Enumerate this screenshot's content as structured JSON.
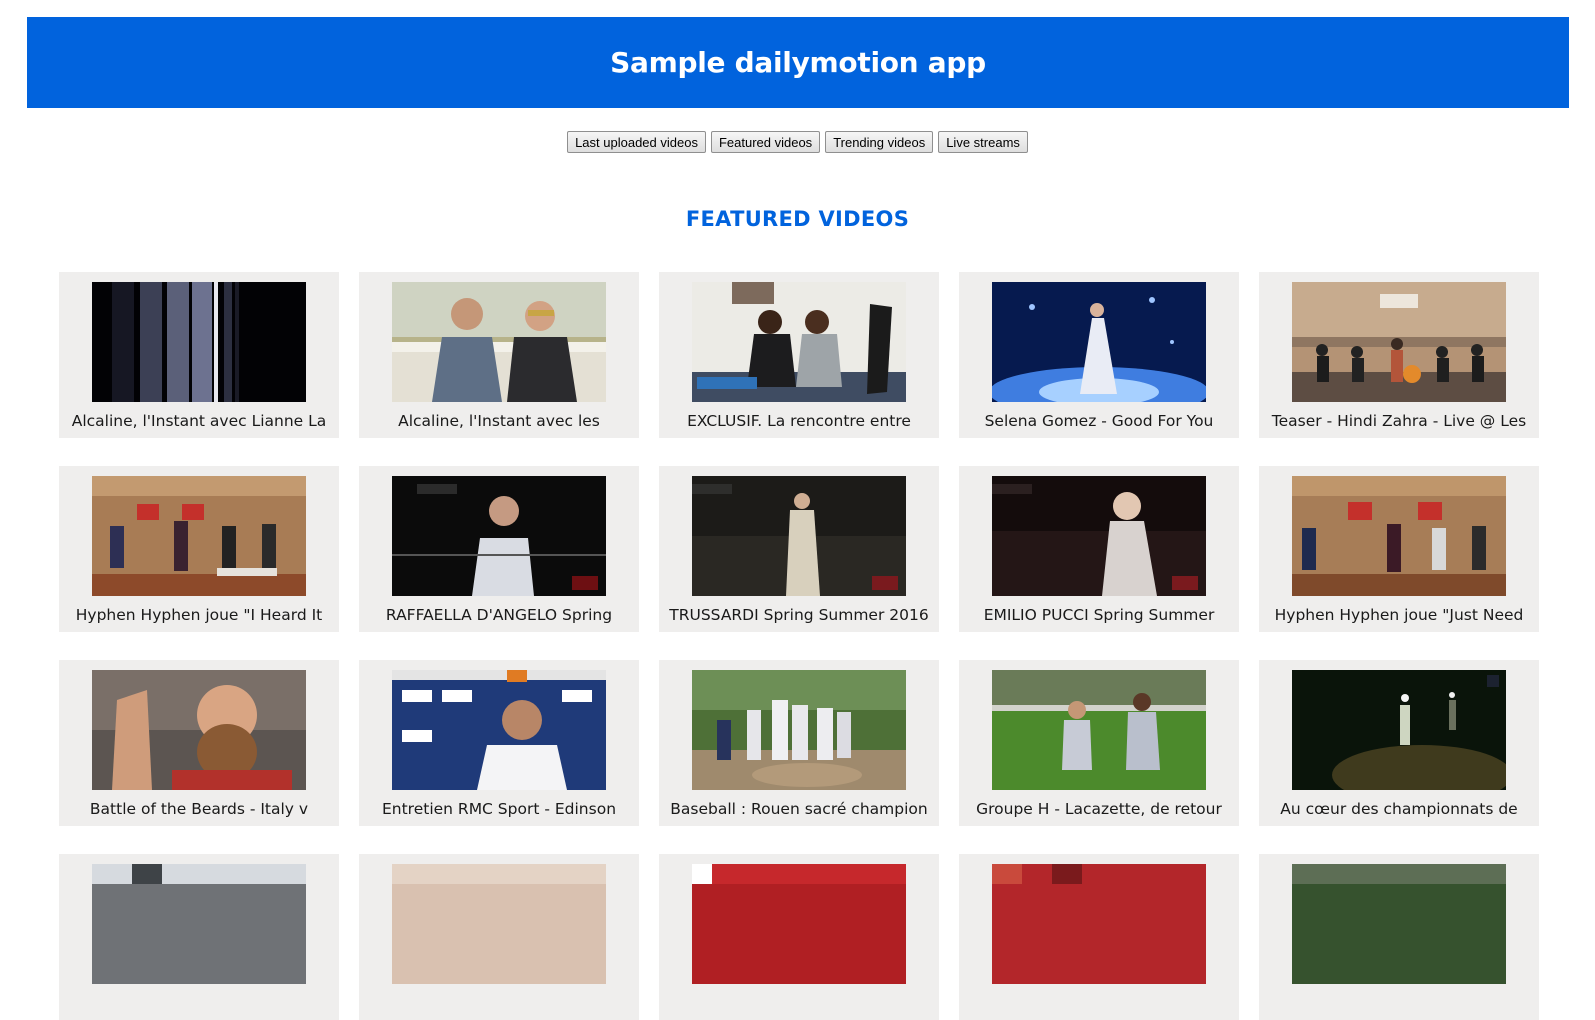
{
  "app": {
    "title": "Sample dailymotion app"
  },
  "nav": {
    "buttons": [
      "Last uploaded videos",
      "Featured videos",
      "Trending videos",
      "Live streams"
    ]
  },
  "section": {
    "title": "FEATURED VIDEOS"
  },
  "videos": [
    {
      "title": "Alcaline, l'Instant avec Lianne La"
    },
    {
      "title": "Alcaline, l'Instant avec les"
    },
    {
      "title": "EXCLUSIF. La rencontre entre"
    },
    {
      "title": "Selena Gomez - Good For You"
    },
    {
      "title": "Teaser - Hindi Zahra - Live @ Les"
    },
    {
      "title": "Hyphen Hyphen joue \"I Heard It"
    },
    {
      "title": "RAFFAELLA D'ANGELO Spring"
    },
    {
      "title": "TRUSSARDI Spring Summer 2016"
    },
    {
      "title": "EMILIO PUCCI Spring Summer"
    },
    {
      "title": "Hyphen Hyphen joue \"Just Need"
    },
    {
      "title": "Battle of the Beards - Italy v"
    },
    {
      "title": "Entretien RMC Sport - Edinson"
    },
    {
      "title": "Baseball : Rouen sacré champion"
    },
    {
      "title": "Groupe H - Lacazette, de retour"
    },
    {
      "title": "Au cœur des championnats de"
    },
    {
      "title": ""
    },
    {
      "title": ""
    },
    {
      "title": ""
    },
    {
      "title": ""
    },
    {
      "title": ""
    }
  ],
  "colors": {
    "brand": "#0163dd",
    "card_bg": "#efeeed"
  }
}
